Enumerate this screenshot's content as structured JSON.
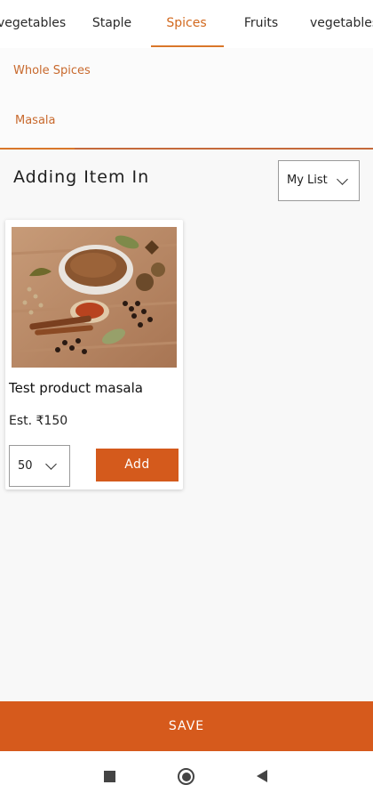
{
  "categories": {
    "tabs": [
      {
        "label": "vegetables",
        "active": false
      },
      {
        "label": "Staple",
        "active": false
      },
      {
        "label": "Spices",
        "active": true
      },
      {
        "label": "Fruits",
        "active": false
      },
      {
        "label": "vegetables",
        "active": false
      }
    ],
    "accent_color": "#d2691e"
  },
  "subcategories": [
    {
      "label": "Whole Spices"
    },
    {
      "label": "Masala"
    }
  ],
  "list_section": {
    "title": "Adding Item In",
    "selected_list": "My List"
  },
  "products": [
    {
      "name": "Test product masala",
      "price": "Est. ₹150",
      "quantity": "50",
      "add_label": "Add",
      "image": "spices-photo"
    }
  ],
  "footer": {
    "save_label": "SAVE",
    "save_color": "#d65a1c"
  },
  "system_nav": {
    "icons": [
      "recent-apps-icon",
      "home-icon",
      "back-icon"
    ]
  }
}
